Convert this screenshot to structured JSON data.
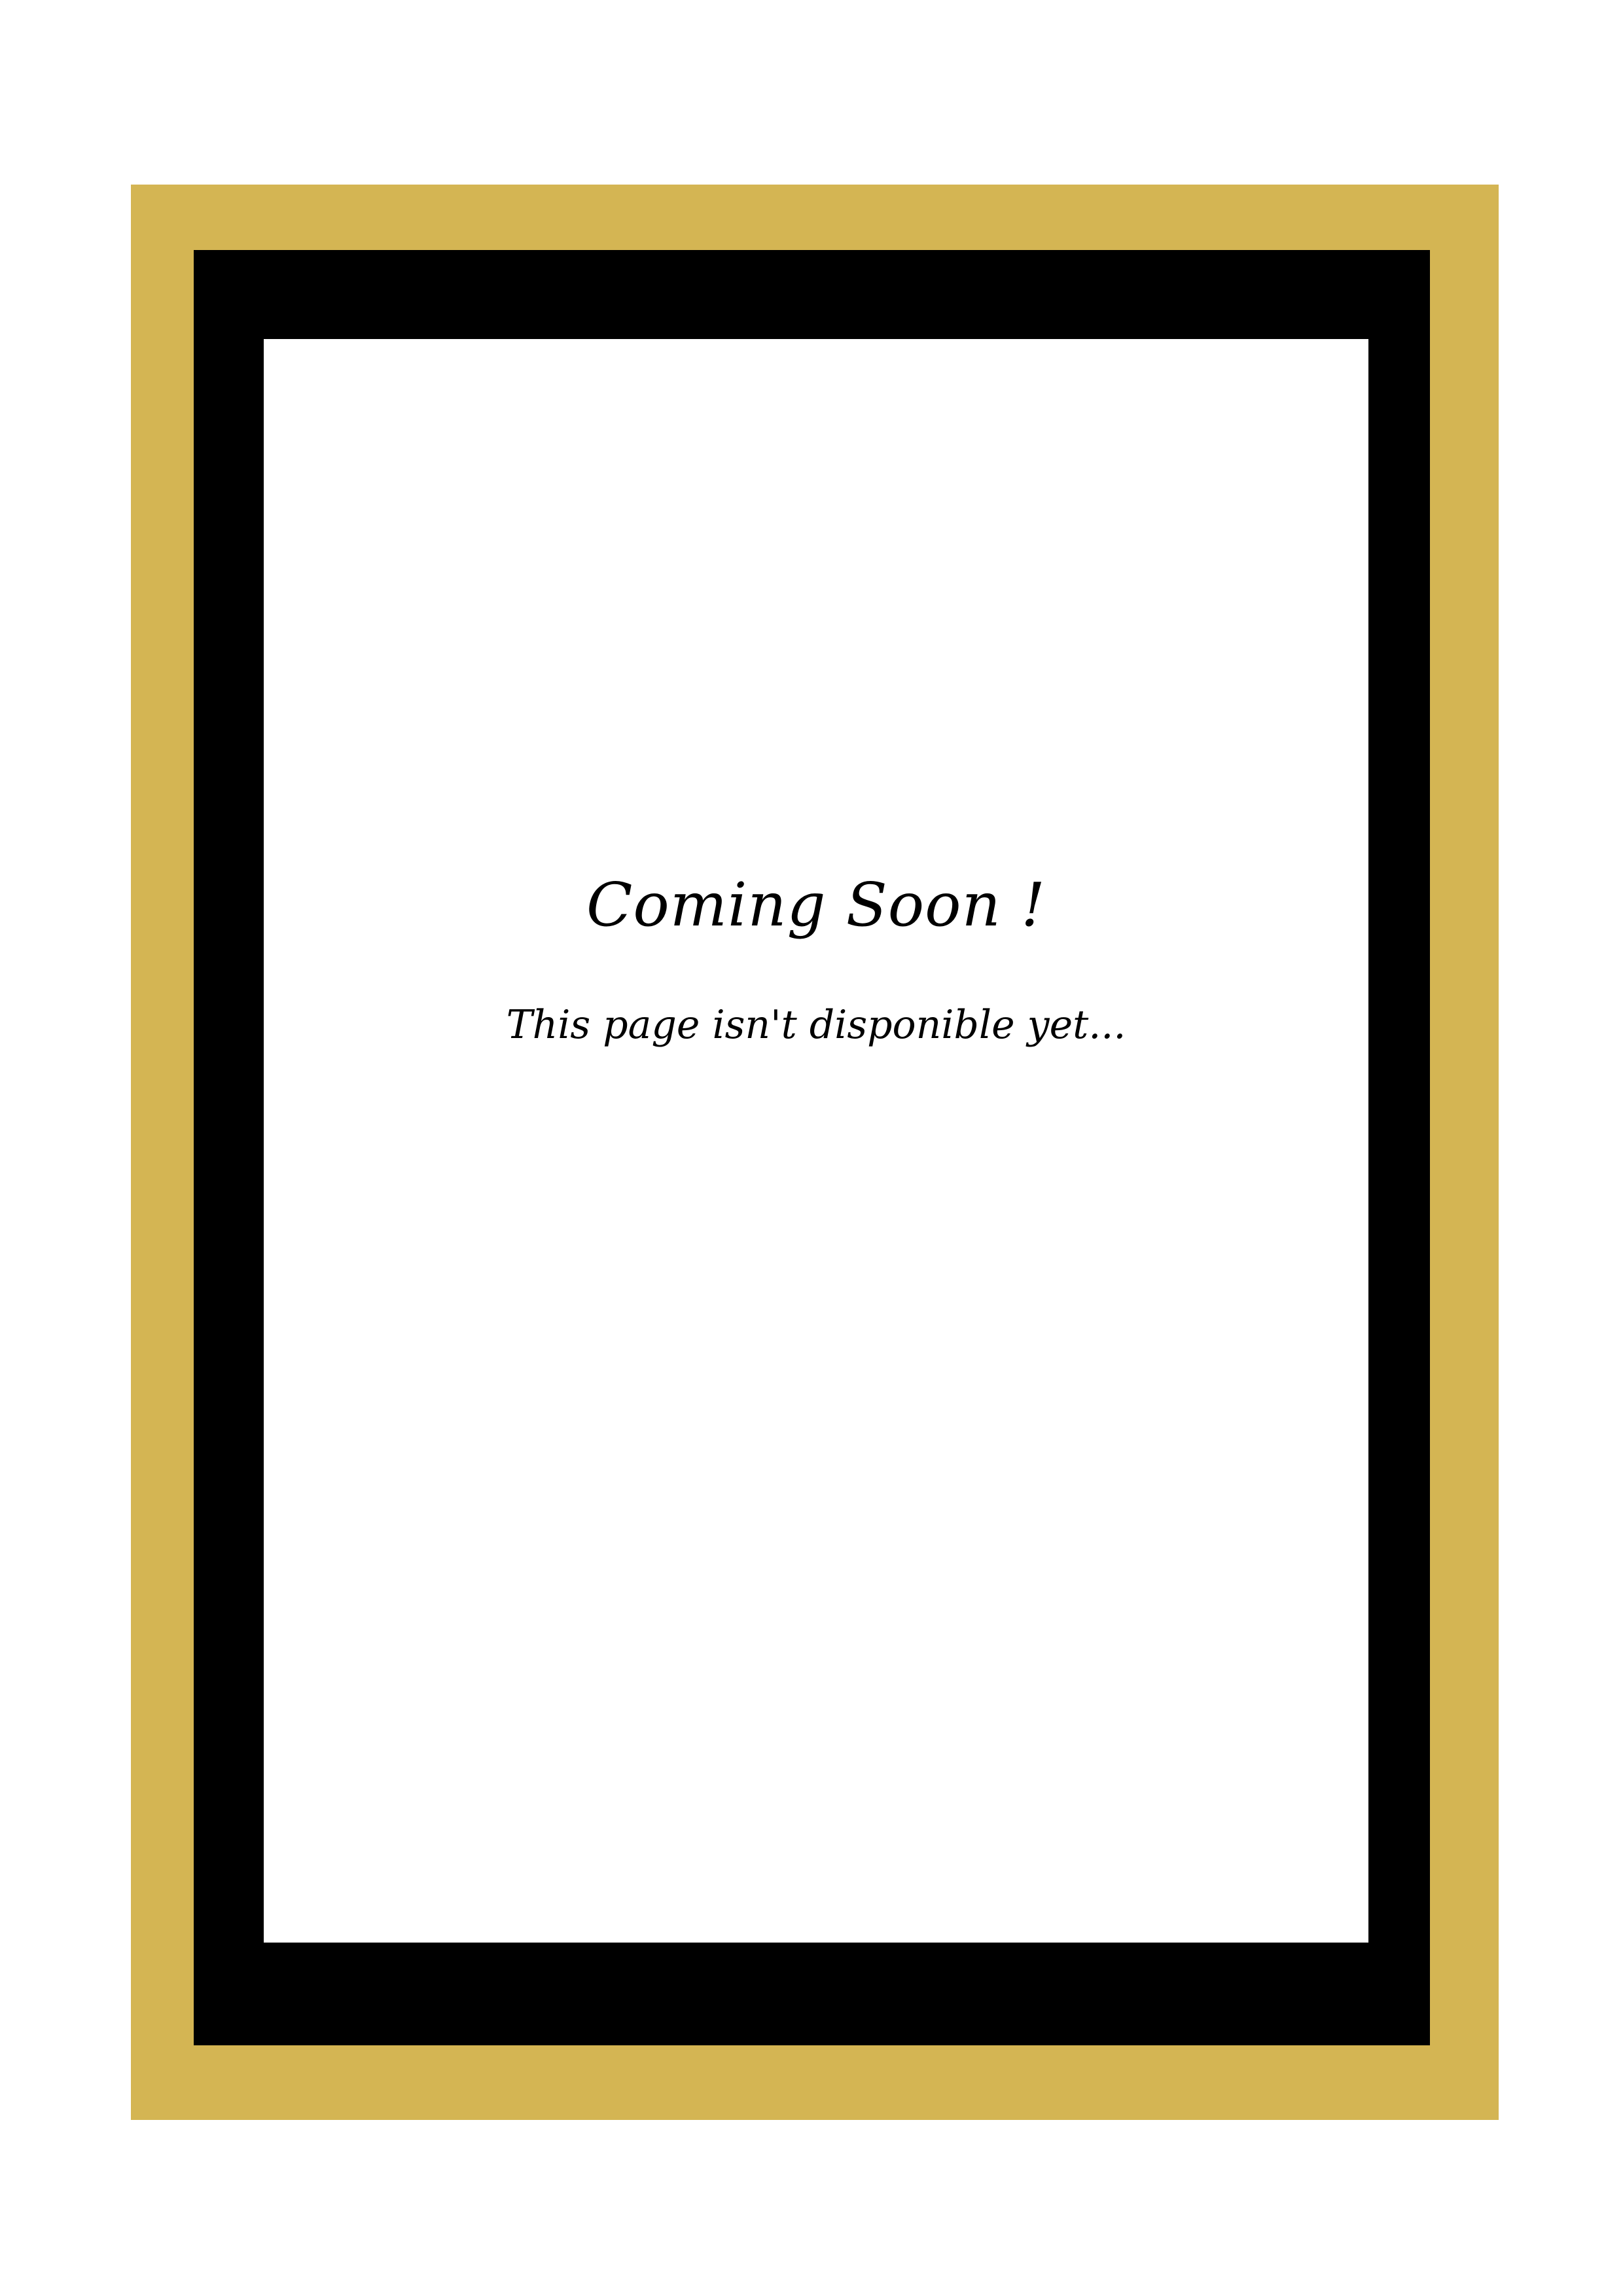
{
  "page": {
    "heading": "Coming Soon !",
    "message": "This page isn't disponible yet..."
  },
  "colors": {
    "outer_frame": "#D4B553",
    "inner_frame": "#000000",
    "panel_background": "#FFFFFF",
    "text": "#000000"
  }
}
